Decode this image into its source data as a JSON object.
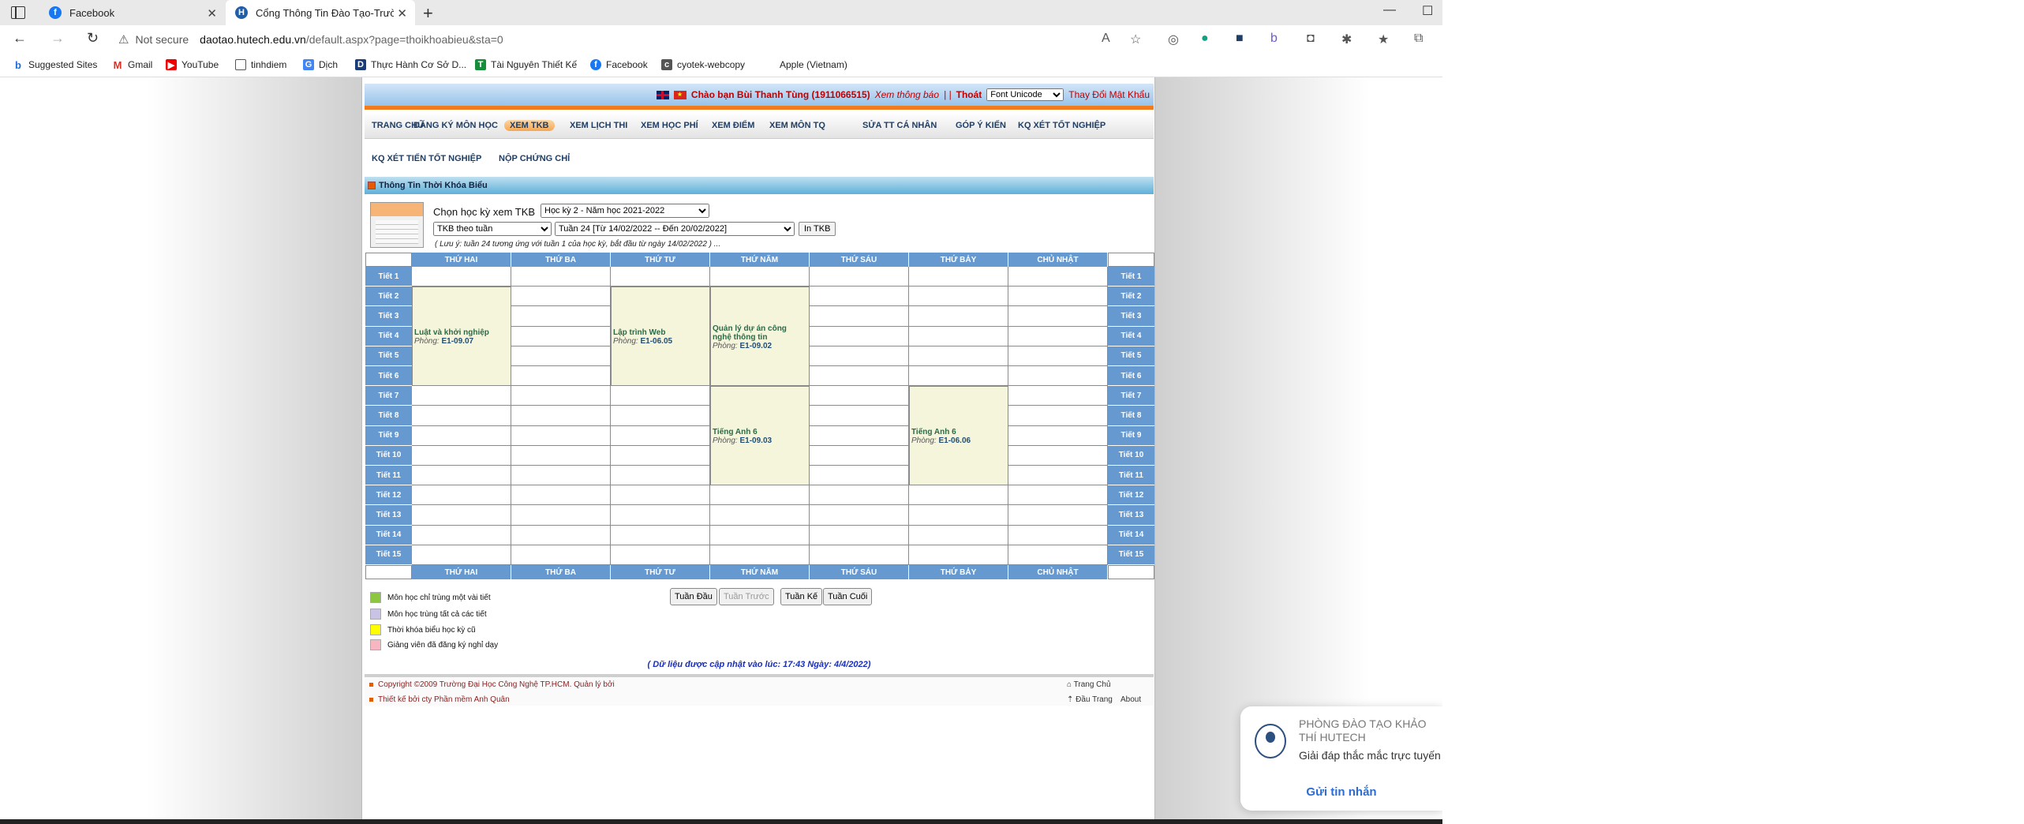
{
  "browser": {
    "tabs": [
      {
        "title": "Facebook",
        "active": false
      },
      {
        "title": "Cổng Thông Tin Đào Tạo-Trường...",
        "active": true
      }
    ],
    "address": {
      "security": "Not secure",
      "host": "daotao.hutech.edu.vn",
      "path": "/default.aspx?page=thoikhoabieu&sta=0"
    },
    "bookmarks": [
      "Suggested Sites",
      "Gmail",
      "YouTube",
      "tinhdiem",
      "Dịch",
      "Thực Hành Cơ Sở D...",
      "Tài Nguyên Thiết Kế",
      "Facebook",
      "cyotek-webcopy",
      "Apple (Vietnam)"
    ]
  },
  "header": {
    "greeting": "Chào bạn Bùi Thanh Tùng (1911066515)",
    "view_notice": "Xem thông báo",
    "separator": "| |",
    "logout": "Thoát",
    "font_select": "Font Unicode",
    "change_password": "Thay Đổi Mật Khẩu"
  },
  "menu": {
    "row1": [
      "TRANG CHỦ",
      "ĐĂNG KÝ MÔN HỌC",
      "XEM TKB",
      "XEM LỊCH THI",
      "XEM HỌC PHÍ",
      "XEM ĐIỂM",
      "XEM MÔN TQ",
      "SỬA TT CÁ NHÂN",
      "GÓP Ý KIẾN",
      "KQ XÉT TỐT NGHIỆP"
    ],
    "row2": [
      "KQ XÉT TIẾN TỐT NGHIỆP",
      "NỘP CHỨNG CHỈ"
    ],
    "active": "XEM TKB"
  },
  "section_title": "Thông Tin Thời Khóa Biểu",
  "controls": {
    "semester_label": "Chọn học kỳ xem TKB",
    "semester_value": "Học kỳ 2 - Năm học 2021-2022",
    "mode_value": "TKB theo tuần",
    "week_value": "Tuần 24 [Từ 14/02/2022 -- Đến 20/02/2022]",
    "print_button": "In TKB",
    "note": "( Lưu ý: tuần 24 tương ứng với tuần 1 của học kỳ, bắt đầu từ ngày 14/02/2022 ) ..."
  },
  "schedule": {
    "days": [
      "THỨ HAI",
      "THỨ BA",
      "THỨ TƯ",
      "THỨ NĂM",
      "THỨ SÁU",
      "THỨ BẢY",
      "CHỦ NHẬT"
    ],
    "periods": [
      "Tiết 1",
      "Tiết 2",
      "Tiết 3",
      "Tiết 4",
      "Tiết 5",
      "Tiết 6",
      "Tiết 7",
      "Tiết 8",
      "Tiết 9",
      "Tiết 10",
      "Tiết 11",
      "Tiết 12",
      "Tiết 13",
      "Tiết 14",
      "Tiết 15"
    ],
    "room_label": "Phòng:",
    "courses": [
      {
        "name": "Luật và khởi nghiệp",
        "room": "E1-09.07",
        "day": 0,
        "start": 2,
        "span": 5
      },
      {
        "name": "Lập trình Web",
        "room": "E1-06.05",
        "day": 2,
        "start": 2,
        "span": 5
      },
      {
        "name": "Quản lý dự án công nghệ thông tin",
        "room": "E1-09.02",
        "day": 3,
        "start": 2,
        "span": 5
      },
      {
        "name": "Tiếng Anh 6",
        "room": "E1-09.03",
        "day": 3,
        "start": 7,
        "span": 5
      },
      {
        "name": "Tiếng Anh 6",
        "room": "E1-06.06",
        "day": 5,
        "start": 7,
        "span": 5
      }
    ]
  },
  "legend": [
    {
      "label": "Môn học chỉ trùng một vài tiết",
      "color": "#8dc63f"
    },
    {
      "label": "Môn học trùng tất cả các tiết",
      "color": "#c9c3e6"
    },
    {
      "label": "Thời khóa biểu học kỳ cũ",
      "color": "#ffff00"
    },
    {
      "label": "Giảng viên đã đăng ký nghỉ dạy",
      "color": "#f7b6c2"
    }
  ],
  "week_nav": {
    "first": "Tuần Đầu",
    "prev": "Tuần Trước",
    "next": "Tuần Kế",
    "last": "Tuần Cuối"
  },
  "updated": "( Dữ liệu được cập nhật vào lúc: 17:43 Ngày: 4/4/2022)",
  "footer": {
    "copyright": "Copyright ©2009 Trường Đại Học Công Nghệ TP.HCM. Quản lý bởi",
    "designer": "Thiết kế bởi cty Phần mềm Anh Quân",
    "home": "Trang Chủ",
    "top": "Đầu Trang",
    "about": "About"
  },
  "chat": {
    "title": "PHÒNG ĐÀO TẠO KHẢO THÍ HUTECH",
    "subtitle": "Giải đáp thắc mắc trực tuyến",
    "send": "Gửi tin nhắn"
  }
}
